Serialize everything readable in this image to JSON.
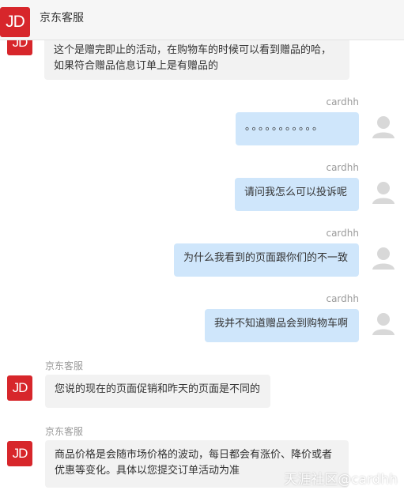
{
  "header": {
    "logo_text": "JD",
    "title": "京东客服"
  },
  "messages": [
    {
      "side": "left",
      "sender": "",
      "text_lines": [
        "这个是赠完即止的活动，在购物车的时候可以看到赠品的哈，",
        "如果符合赠品信息订单上是有赠品的"
      ]
    },
    {
      "side": "right",
      "sender": "cardhh",
      "text": "。。。。。。。。。。。"
    },
    {
      "side": "right",
      "sender": "cardhh",
      "text": "请问我怎么可以投诉呢"
    },
    {
      "side": "right",
      "sender": "cardhh",
      "text": "为什么我看到的页面跟你们的不一致"
    },
    {
      "side": "right",
      "sender": "cardhh",
      "text": "我并不知道赠品会到购物车啊"
    },
    {
      "side": "left",
      "sender": "京东客服",
      "text": "您说的现在的页面促销和昨天的页面是不同的"
    },
    {
      "side": "left",
      "sender": "京东客服",
      "text_lines": [
        "商品价格是会随市场价格的波动，每日都会有涨价、降价或者",
        "优惠等变化。具体以您提交订单活动为准"
      ]
    }
  ],
  "avatar_jd_text": "JD",
  "watermark": "天涯社区@cardhh",
  "colors": {
    "brand_red": "#d7262b",
    "bubble_right": "#cfe6fb",
    "bubble_left": "#f2f2f2"
  },
  "icons": {
    "user_avatar": "default-user-avatar-icon"
  }
}
